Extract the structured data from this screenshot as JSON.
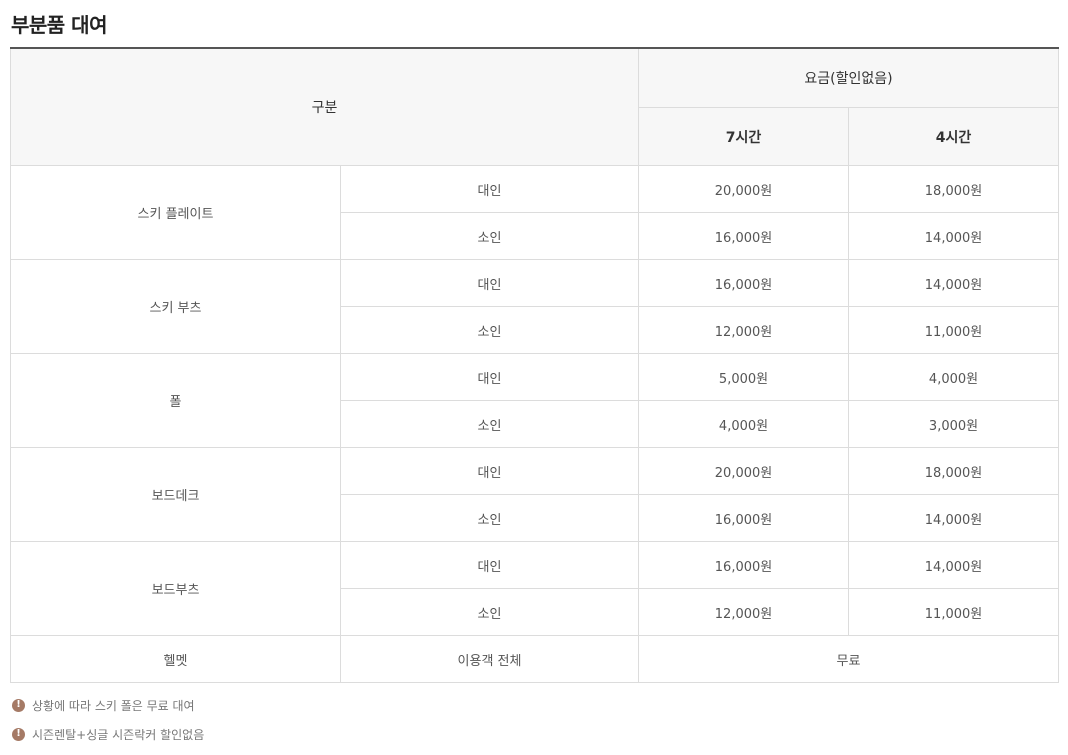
{
  "page_title": "부분품 대여",
  "table": {
    "header_category": "구분",
    "header_fee": "요금(할인없음)",
    "header_col_7h": "7시간",
    "header_col_4h": "4시간",
    "groups": [
      {
        "name": "스키 플레이트",
        "rows": [
          {
            "type": "대인",
            "h7": "20,000원",
            "h4": "18,000원"
          },
          {
            "type": "소인",
            "h7": "16,000원",
            "h4": "14,000원"
          }
        ]
      },
      {
        "name": "스키 부츠",
        "rows": [
          {
            "type": "대인",
            "h7": "16,000원",
            "h4": "14,000원"
          },
          {
            "type": "소인",
            "h7": "12,000원",
            "h4": "11,000원"
          }
        ]
      },
      {
        "name": "폴",
        "rows": [
          {
            "type": "대인",
            "h7": "5,000원",
            "h4": "4,000원"
          },
          {
            "type": "소인",
            "h7": "4,000원",
            "h4": "3,000원"
          }
        ]
      },
      {
        "name": "보드데크",
        "rows": [
          {
            "type": "대인",
            "h7": "20,000원",
            "h4": "18,000원"
          },
          {
            "type": "소인",
            "h7": "16,000원",
            "h4": "14,000원"
          }
        ]
      },
      {
        "name": "보드부츠",
        "rows": [
          {
            "type": "대인",
            "h7": "16,000원",
            "h4": "14,000원"
          },
          {
            "type": "소인",
            "h7": "12,000원",
            "h4": "11,000원"
          }
        ]
      }
    ],
    "helmet": {
      "name": "헬멧",
      "type": "이용객 전체",
      "fee": "무료"
    }
  },
  "notes": [
    {
      "icon": "exclamation-icon",
      "text": "상황에 따라 스키 폴은 무료 대여"
    },
    {
      "icon": "exclamation-icon",
      "text": "시즌렌탈+싱글 시즌락커 할인없음"
    }
  ],
  "colors": {
    "note_icon": "#a57a66",
    "header_bg": "#f7f7f7",
    "border": "#dcdcdc"
  }
}
